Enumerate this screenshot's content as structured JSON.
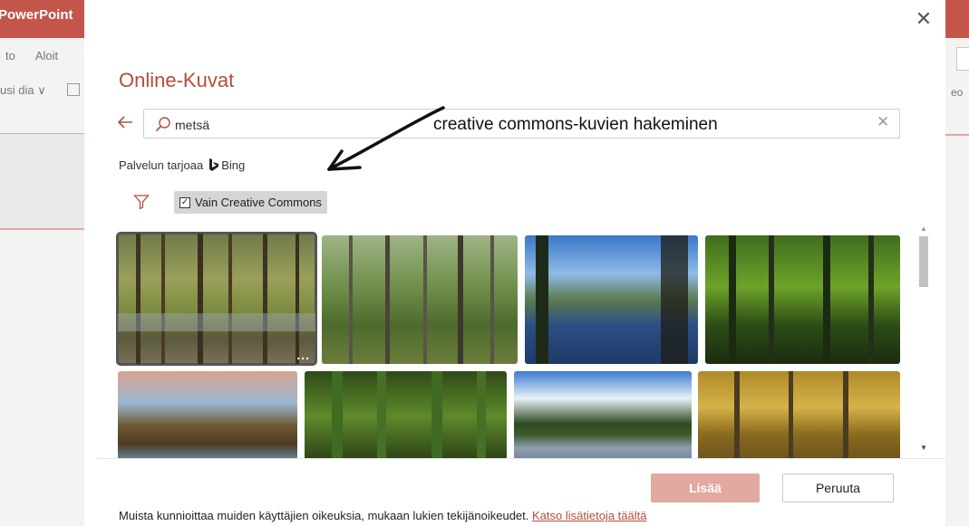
{
  "app": {
    "title": "PowerPoint",
    "tabs": [
      "to",
      "Aloit"
    ],
    "ribbon_item": "usi dia ∨",
    "right_text": "eo"
  },
  "dialog": {
    "title": "Online-Kuvat",
    "search": {
      "value": "metsä",
      "placeholder": ""
    },
    "annotation": "creative commons-kuvien hakeminen",
    "provider_prefix": "Palvelun tarjoaa",
    "provider_name": "Bing",
    "cc_filter_label": "Vain Creative Commons",
    "more_options": "...",
    "insert_label": "Lisää",
    "cancel_label": "Peruuta",
    "notice_text": "Muista kunnioittaa muiden käyttäjien oikeuksia, mukaan lukien tekijänoikeudet.",
    "notice_link": "Katso lisätietoja täältä"
  },
  "colors": {
    "accent": "#b24e3a",
    "titlebar": "#c4554a",
    "insert_disabled": "#e2a9a1"
  },
  "icons": [
    "back-arrow-icon",
    "search-icon",
    "clear-icon",
    "bing-logo-icon",
    "filter-icon",
    "checkbox-icon",
    "close-icon"
  ]
}
